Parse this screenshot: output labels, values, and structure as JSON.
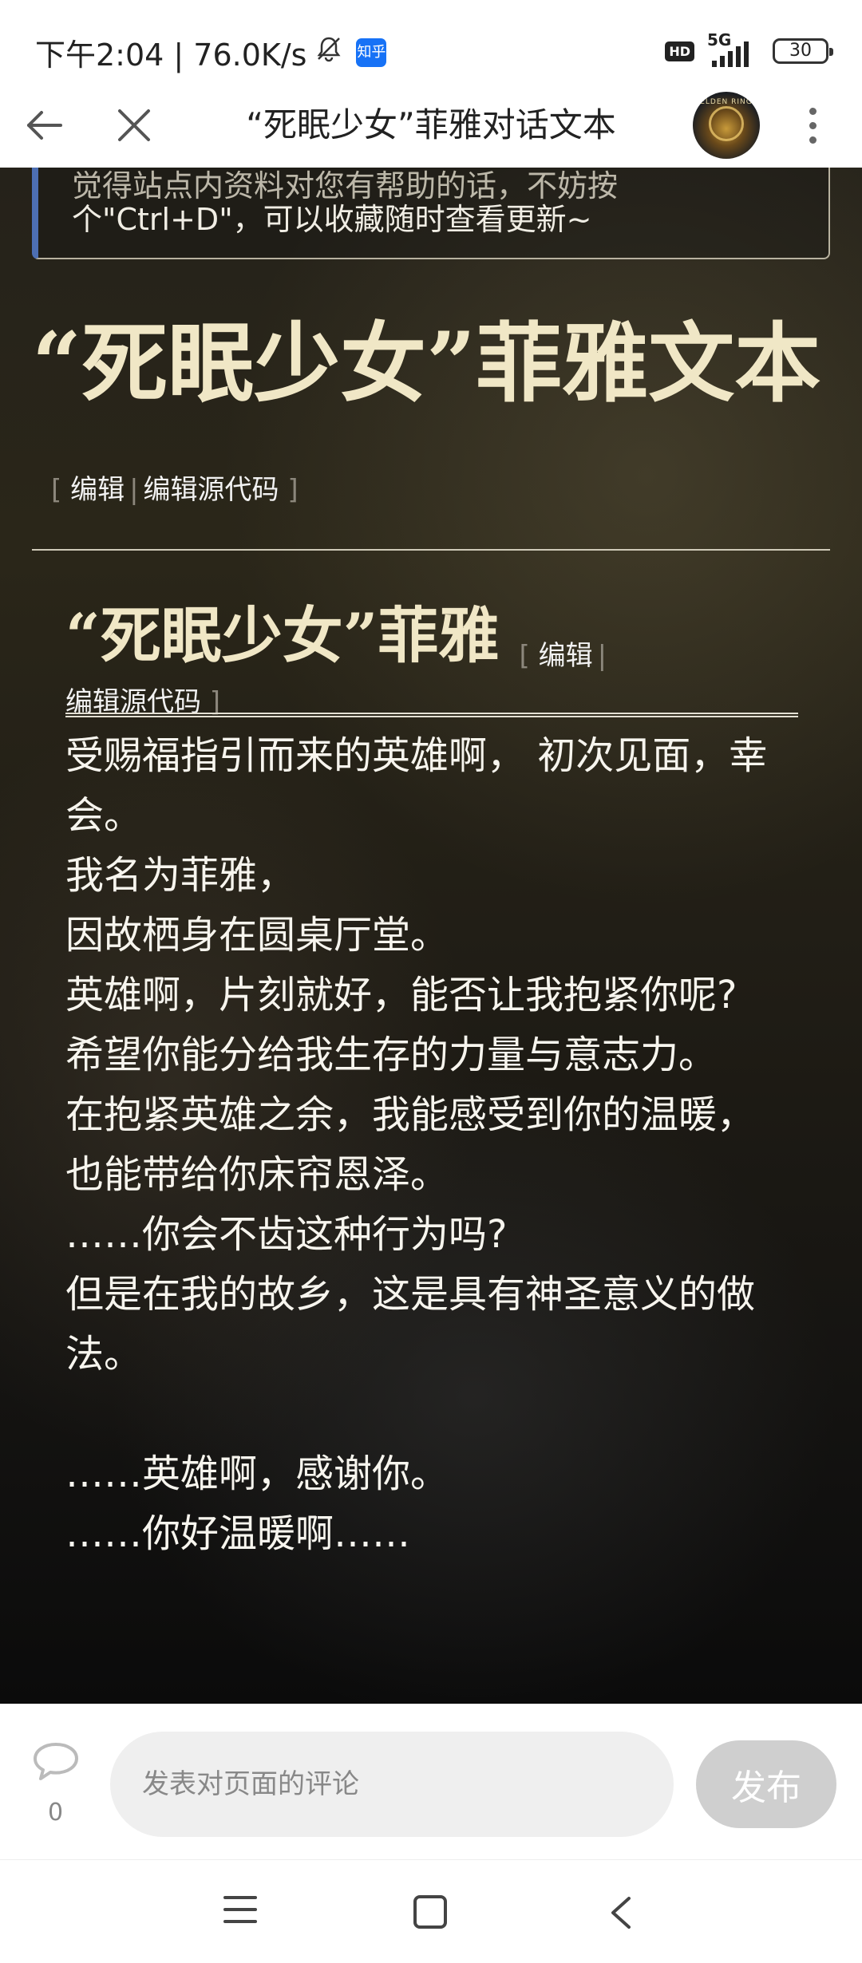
{
  "status_bar": {
    "time_speed": "下午2:04 | 76.0K/s",
    "app_badge": "知乎",
    "hd": "HD",
    "network": "5G",
    "battery": "30"
  },
  "toolbar": {
    "title": "“死眠少女”菲雅对话文本",
    "avatar_text": "ELDEN RING"
  },
  "notice": {
    "cut_line": "觉得站点内资料对您有帮助的话，不妨按",
    "line": "个\"Ctrl+D\"，可以收藏随时查看更新~"
  },
  "page": {
    "title": "“死眠少女”菲雅文本",
    "edit_label": "编辑",
    "edit_source_label": "编辑源代码"
  },
  "section": {
    "title": "“死眠少女”菲雅",
    "edit_label": "编辑",
    "edit_source_label": "编辑源代码"
  },
  "dialog_lines": [
    "受赐福指引而来的英雄啊， 初次见面，幸会。",
    "我名为菲雅，",
    "因故栖身在圆桌厅堂。",
    "英雄啊，片刻就好，能否让我抱紧你呢?",
    "希望你能分给我生存的力量与意志力。",
    "在抱紧英雄之余，我能感受到你的温暖，",
    "也能带给你床帘恩泽。",
    "……你会不齿这种行为吗?",
    "但是在我的故乡，这是具有神圣意义的做法。",
    "",
    "……英雄啊，感谢你。",
    "……你好温暖啊……"
  ],
  "comment": {
    "count": "0",
    "placeholder": "发表对页面的评论",
    "publish_label": "发布"
  }
}
